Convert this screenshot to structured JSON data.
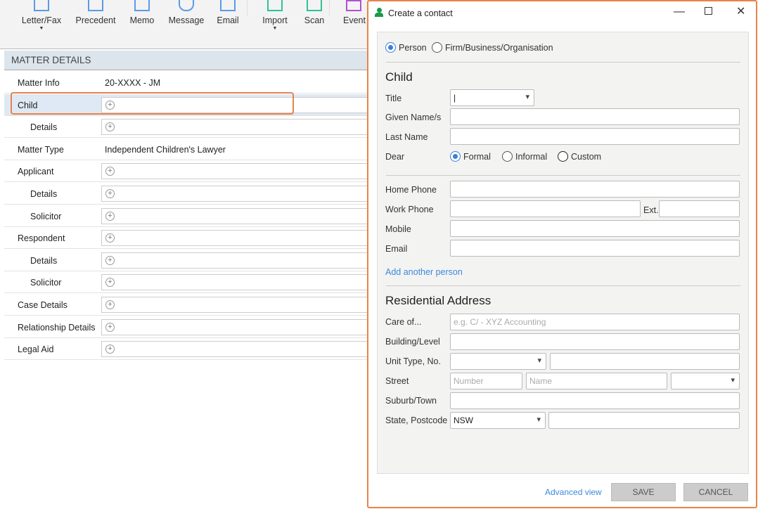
{
  "toolbar": {
    "items": [
      {
        "label": "Letter/Fax",
        "dropdown": true
      },
      {
        "label": "Precedent"
      },
      {
        "label": "Memo"
      },
      {
        "label": "Message"
      },
      {
        "label": "Email"
      },
      {
        "label": "Import",
        "dropdown": true
      },
      {
        "label": "Scan"
      },
      {
        "label": "Event"
      }
    ]
  },
  "matter": {
    "header": "MATTER DETAILS",
    "rows": [
      {
        "label": "Matter Info",
        "value": "20-XXXX - JM"
      },
      {
        "label": "Child"
      },
      {
        "label": "Details",
        "sub": true
      },
      {
        "label": "Matter Type",
        "value": "Independent Children's Lawyer"
      },
      {
        "label": "Applicant"
      },
      {
        "label": "Details",
        "sub": true
      },
      {
        "label": "Solicitor",
        "sub": true
      },
      {
        "label": "Respondent"
      },
      {
        "label": "Details",
        "sub": true
      },
      {
        "label": "Solicitor",
        "sub": true
      },
      {
        "label": "Case Details"
      },
      {
        "label": "Relationship Details"
      },
      {
        "label": "Legal Aid"
      }
    ]
  },
  "dialog": {
    "title": "Create a contact",
    "type_options": [
      "Person",
      "Firm/Business/Organisation"
    ],
    "section1": "Child",
    "labels": {
      "title": "Title",
      "given": "Given Name/s",
      "last": "Last Name",
      "dear": "Dear",
      "home": "Home Phone",
      "work": "Work Phone",
      "ext": "Ext.",
      "mobile": "Mobile",
      "email": "Email",
      "care": "Care of...",
      "building": "Building/Level",
      "unit": "Unit Type, No.",
      "street": "Street",
      "suburb": "Suburb/Town",
      "state": "State, Postcode"
    },
    "dear_options": [
      "Formal",
      "Informal",
      "Custom"
    ],
    "add_person": "Add another person",
    "section2": "Residential Address",
    "placeholders": {
      "care": "e.g. C/ - XYZ Accounting",
      "number": "Number",
      "name": "Name"
    },
    "state_value": "NSW",
    "advanced": "Advanced view",
    "save": "SAVE",
    "cancel": "CANCEL"
  }
}
